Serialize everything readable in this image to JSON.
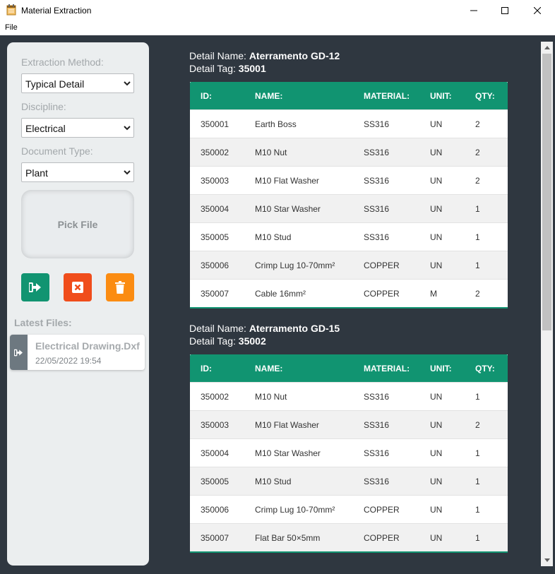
{
  "window": {
    "title": "Material Extraction",
    "icon": "document-notepad-icon",
    "menu": [
      "File"
    ]
  },
  "sidebar": {
    "extraction_method": {
      "label": "Extraction Method:",
      "value": "Typical Detail"
    },
    "discipline": {
      "label": "Discipline:",
      "value": "Electrical"
    },
    "document_type": {
      "label": "Document Type:",
      "value": "Plant"
    },
    "pick_file_label": "Pick File",
    "buttons": [
      {
        "name": "export",
        "icon": "sign-out-icon",
        "color": "#119471"
      },
      {
        "name": "clear",
        "icon": "close-box-icon",
        "color": "#f04d1b"
      },
      {
        "name": "delete",
        "icon": "trash-icon",
        "color": "#fb8c12"
      }
    ],
    "latest_files_label": "Latest Files:",
    "latest_files": [
      {
        "name": "Electrical Drawing.Dxf",
        "date": "22/05/2022 19:54"
      }
    ]
  },
  "details": [
    {
      "name_label": "Detail Name:",
      "name": "Aterramento GD-12",
      "tag_label": "Detail Tag:",
      "tag": "35001",
      "columns": [
        "ID:",
        "NAME:",
        "MATERIAL:",
        "UNIT:",
        "QTY:"
      ],
      "rows": [
        [
          "350001",
          "Earth Boss",
          "SS316",
          "UN",
          "2"
        ],
        [
          "350002",
          "M10 Nut",
          "SS316",
          "UN",
          "2"
        ],
        [
          "350003",
          "M10 Flat Washer",
          "SS316",
          "UN",
          "2"
        ],
        [
          "350004",
          "M10 Star Washer",
          "SS316",
          "UN",
          "1"
        ],
        [
          "350005",
          "M10 Stud",
          "SS316",
          "UN",
          "1"
        ],
        [
          "350006",
          "Crimp Lug 10-70mm²",
          "COPPER",
          "UN",
          "1"
        ],
        [
          "350007",
          "Cable 16mm²",
          "COPPER",
          "M",
          "2"
        ]
      ]
    },
    {
      "name_label": "Detail Name:",
      "name": "Aterramento GD-15",
      "tag_label": "Detail Tag:",
      "tag": "35002",
      "columns": [
        "ID:",
        "NAME:",
        "MATERIAL:",
        "UNIT:",
        "QTY:"
      ],
      "rows": [
        [
          "350002",
          "M10 Nut",
          "SS316",
          "UN",
          "1"
        ],
        [
          "350003",
          "M10 Flat Washer",
          "SS316",
          "UN",
          "2"
        ],
        [
          "350004",
          "M10 Star Washer",
          "SS316",
          "UN",
          "1"
        ],
        [
          "350005",
          "M10 Stud",
          "SS316",
          "UN",
          "1"
        ],
        [
          "350006",
          "Crimp Lug 10-70mm²",
          "COPPER",
          "UN",
          "1"
        ],
        [
          "350007",
          "Flat Bar 50×5mm",
          "COPPER",
          "UN",
          "1"
        ]
      ]
    }
  ],
  "colors": {
    "background": "#2f3740",
    "accent": "#119471",
    "sidebar": "#ebeeef"
  }
}
